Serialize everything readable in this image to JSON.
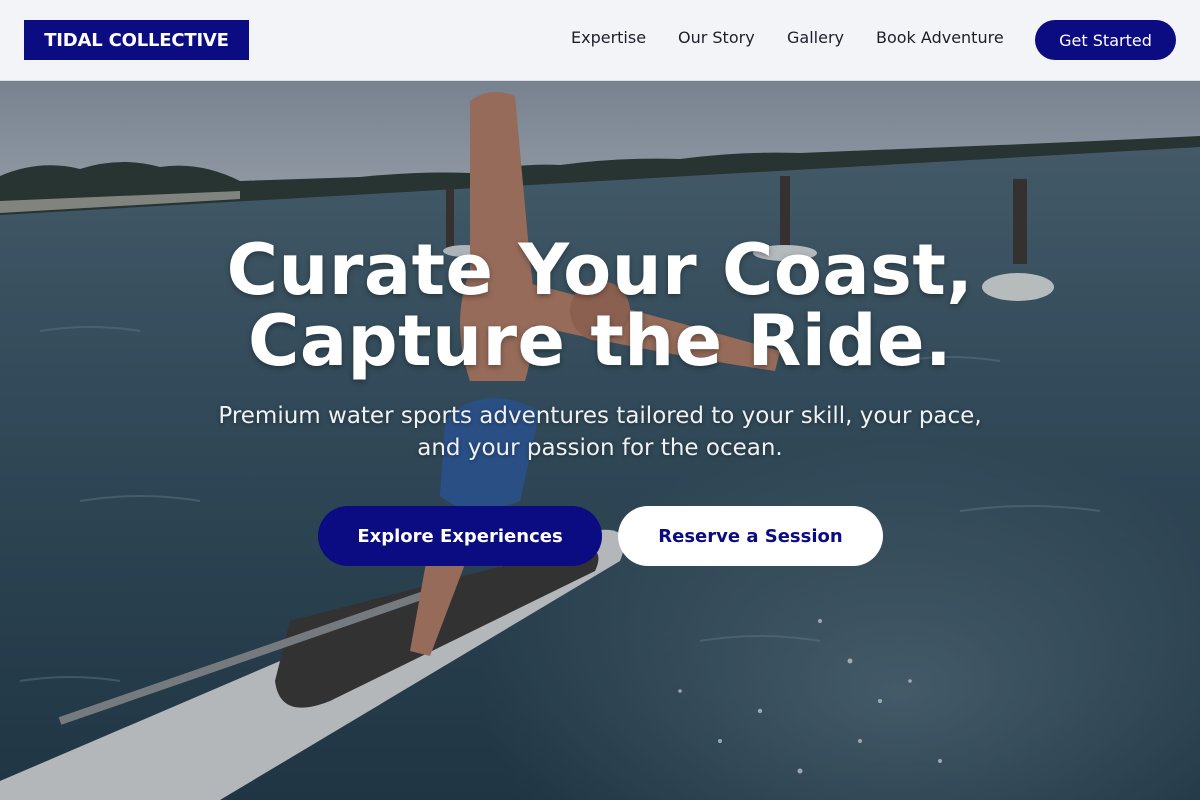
{
  "brand": {
    "name": "TIDAL COLLECTIVE"
  },
  "nav": {
    "links": [
      "Expertise",
      "Our Story",
      "Gallery",
      "Book Adventure"
    ],
    "cta_label": "Get Started"
  },
  "hero": {
    "title_lines": [
      "Curate Your Coast,",
      "Capture the Ride."
    ],
    "subtitle_lines": [
      "Premium water sports adventures tailored to your skill, your pace,",
      "and your passion for the ocean."
    ],
    "primary_button": "Explore Experiences",
    "secondary_button": "Reserve a Session"
  },
  "colors": {
    "brand": "#0b0b82",
    "header_bg": "#f3f4f7",
    "water": "#2f4a58"
  }
}
